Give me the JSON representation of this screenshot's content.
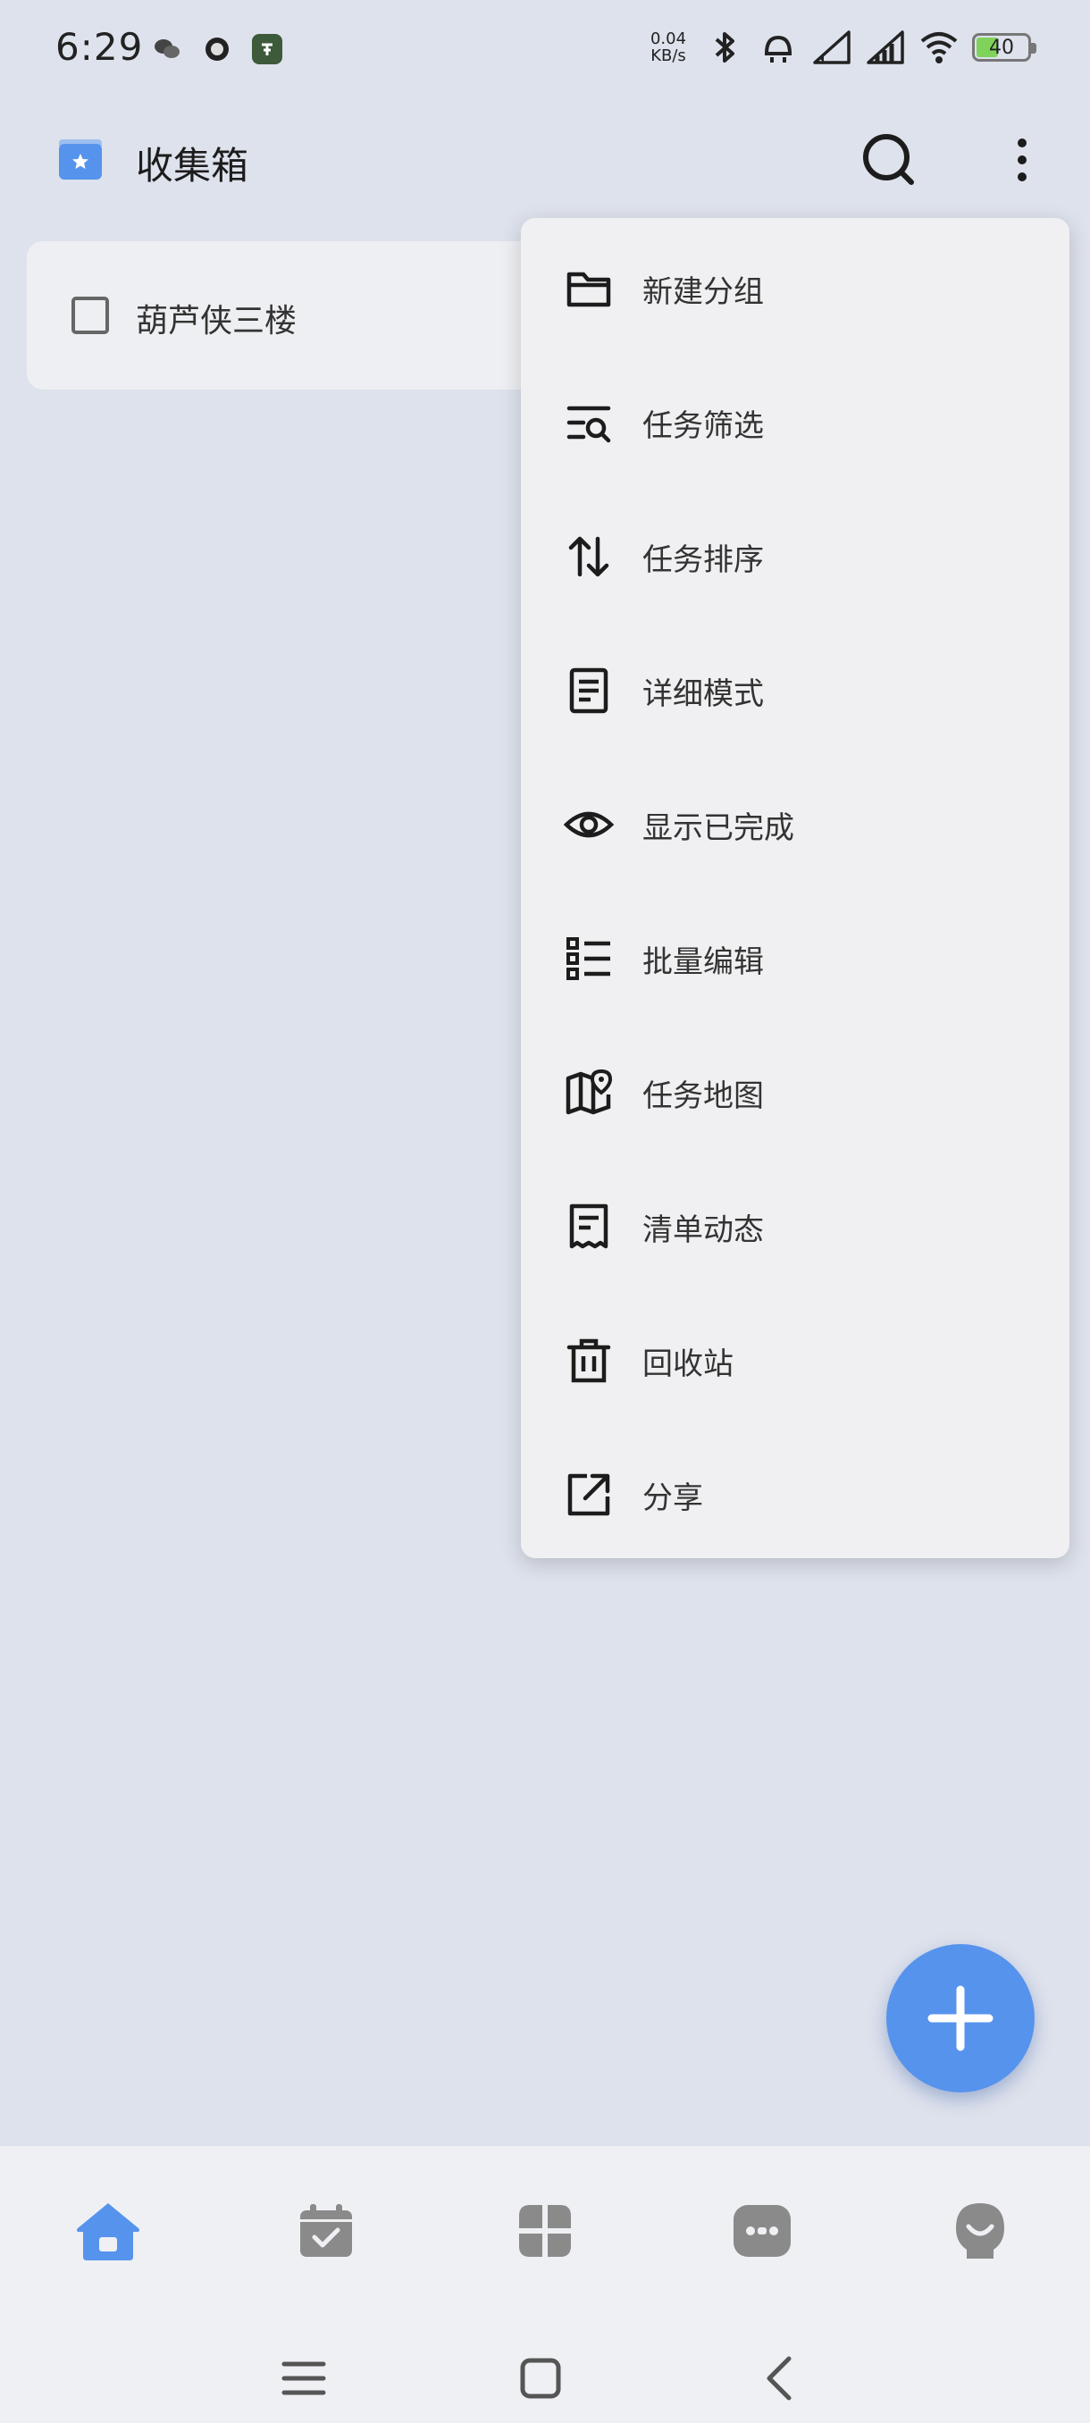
{
  "status_bar": {
    "time": "6:29",
    "net_speed_value": "0.04",
    "net_speed_unit": "KB/s",
    "battery": "40"
  },
  "header": {
    "title": "收集箱"
  },
  "tasks": [
    {
      "label": "葫芦侠三楼",
      "checked": false
    }
  ],
  "menu": {
    "items": [
      {
        "label": "新建分组",
        "icon": "folder-icon"
      },
      {
        "label": "任务筛选",
        "icon": "filter-search-icon"
      },
      {
        "label": "任务排序",
        "icon": "sort-icon"
      },
      {
        "label": "详细模式",
        "icon": "document-icon"
      },
      {
        "label": "显示已完成",
        "icon": "eye-icon"
      },
      {
        "label": "批量编辑",
        "icon": "checklist-icon"
      },
      {
        "label": "任务地图",
        "icon": "map-pin-icon"
      },
      {
        "label": "清单动态",
        "icon": "receipt-icon"
      },
      {
        "label": "回收站",
        "icon": "trash-icon"
      },
      {
        "label": "分享",
        "icon": "share-icon"
      }
    ]
  },
  "colors": {
    "accent": "#5693ec",
    "background": "#dee2ec",
    "inactive_icon": "#8a8a8a"
  }
}
